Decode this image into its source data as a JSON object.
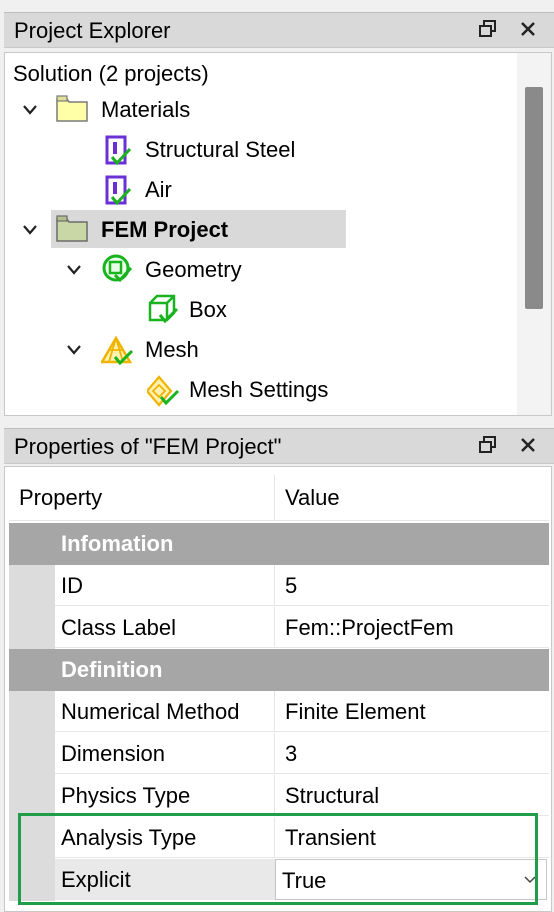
{
  "explorer": {
    "title": "Project Explorer",
    "solution_label": "Solution (2 projects)",
    "nodes": [
      {
        "label": "Materials",
        "icon": "folder-icon"
      },
      {
        "label": "Structural Steel",
        "icon": "material-icon"
      },
      {
        "label": "Air",
        "icon": "material-icon"
      },
      {
        "label": "FEM Project",
        "icon": "folder-icon"
      },
      {
        "label": "Geometry",
        "icon": "geometry-icon"
      },
      {
        "label": "Box",
        "icon": "box-icon"
      },
      {
        "label": "Mesh",
        "icon": "mesh-icon"
      },
      {
        "label": "Mesh Settings",
        "icon": "mesh-settings-icon"
      }
    ]
  },
  "properties": {
    "title": "Properties of \"FEM Project\"",
    "header": {
      "property": "Property",
      "value": "Value"
    },
    "categories": [
      "Infomation",
      "Definition"
    ],
    "rows": [
      {
        "name": "ID",
        "value": "5"
      },
      {
        "name": "Class Label",
        "value": "Fem::ProjectFem"
      },
      {
        "name": "Numerical Method",
        "value": "Finite Element"
      },
      {
        "name": "Dimension",
        "value": "3"
      },
      {
        "name": "Physics Type",
        "value": "Structural"
      },
      {
        "name": "Analysis Type",
        "value": "Transient"
      },
      {
        "name": "Explicit",
        "value": "True"
      }
    ]
  },
  "colors": {
    "highlight_box": "#1e9e49",
    "category_bg": "#a6a6a6",
    "selection_bg": "#d9d9d9",
    "material_icon": "#6b2fd6",
    "check_green": "#19b31f",
    "mesh_yellow": "#f0b400"
  }
}
